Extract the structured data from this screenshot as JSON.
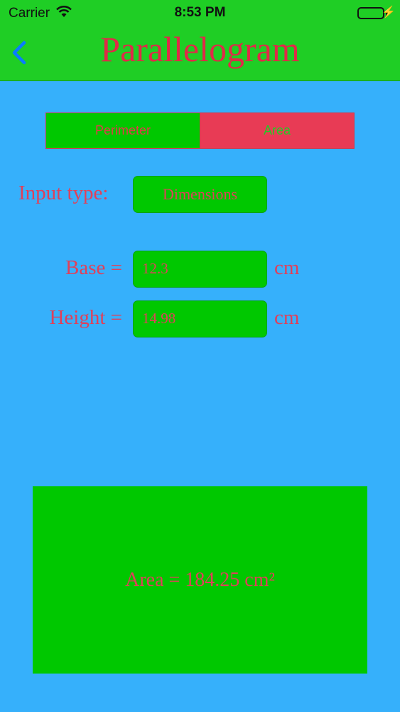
{
  "status": {
    "carrier": "Carrier",
    "time": "8:53 PM"
  },
  "nav": {
    "title": "Parallelogram"
  },
  "segments": {
    "perimeter": "Perimeter",
    "area": "Area"
  },
  "input_type": {
    "label": "Input type:",
    "button": "Dimensions"
  },
  "fields": {
    "base": {
      "label": "Base =",
      "value": "12.3",
      "unit": "cm"
    },
    "height": {
      "label": "Height =",
      "value": "14.98",
      "unit": "cm"
    }
  },
  "result": {
    "text": "Area = 184.25 cm²"
  },
  "colors": {
    "nav": "#1fce25",
    "background": "#36b0fb",
    "accent": "#e0405a",
    "green": "#00c800"
  }
}
